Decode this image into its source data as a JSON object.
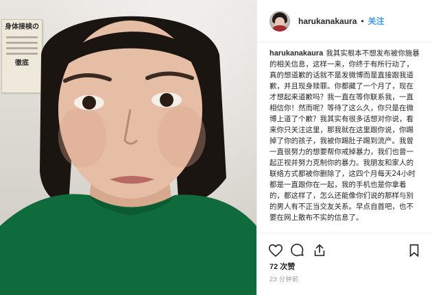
{
  "post": {
    "username": "harukanakaura",
    "separator": "•",
    "follow_label": "关注",
    "caption_text": "我其实根本不想发布被你施暴的相关信息，这样一来，你终于有所行动了，真的想道歉的话就不是发微博而是直接跟我道歉，并且现身赎罪。你都藏了一个月了，现在才想起来道歉吗？我一直在等你联系我，一直相信你！然而呢？等待了这么久，你只是在微博上道了个歉？我其实有很多话想对你说，看来你只关注这里，那我就在这里跟你说，你踢掉了你的孩子，我被你踢肚子踢到流产。我曾一直很努力的想要帮你戒掉暴力，我们也曾一起正视并努力克制你的暴力。我朋友和家人的联络方式都被你删除了，这四个月每天24小时都是一直跟你在一起，我的手机也是你拿着的，都这样了，怎么还能像你们说的那样与别的男人有不正当交友关系。早点自首吧，也不要在网上散布不实的信息了。",
    "likes": "72 次赞",
    "time": "23 分钟前"
  },
  "photo": {
    "notice_title": "身体接検の",
    "notice_title2": "徹底"
  },
  "icons": {
    "like": "heart-icon",
    "comment": "comment-icon",
    "share": "share-icon",
    "save": "bookmark-icon"
  },
  "colors": {
    "follow": "#3897f0",
    "text": "#262626",
    "muted": "#999999",
    "shirt": "#0f6a3c"
  }
}
